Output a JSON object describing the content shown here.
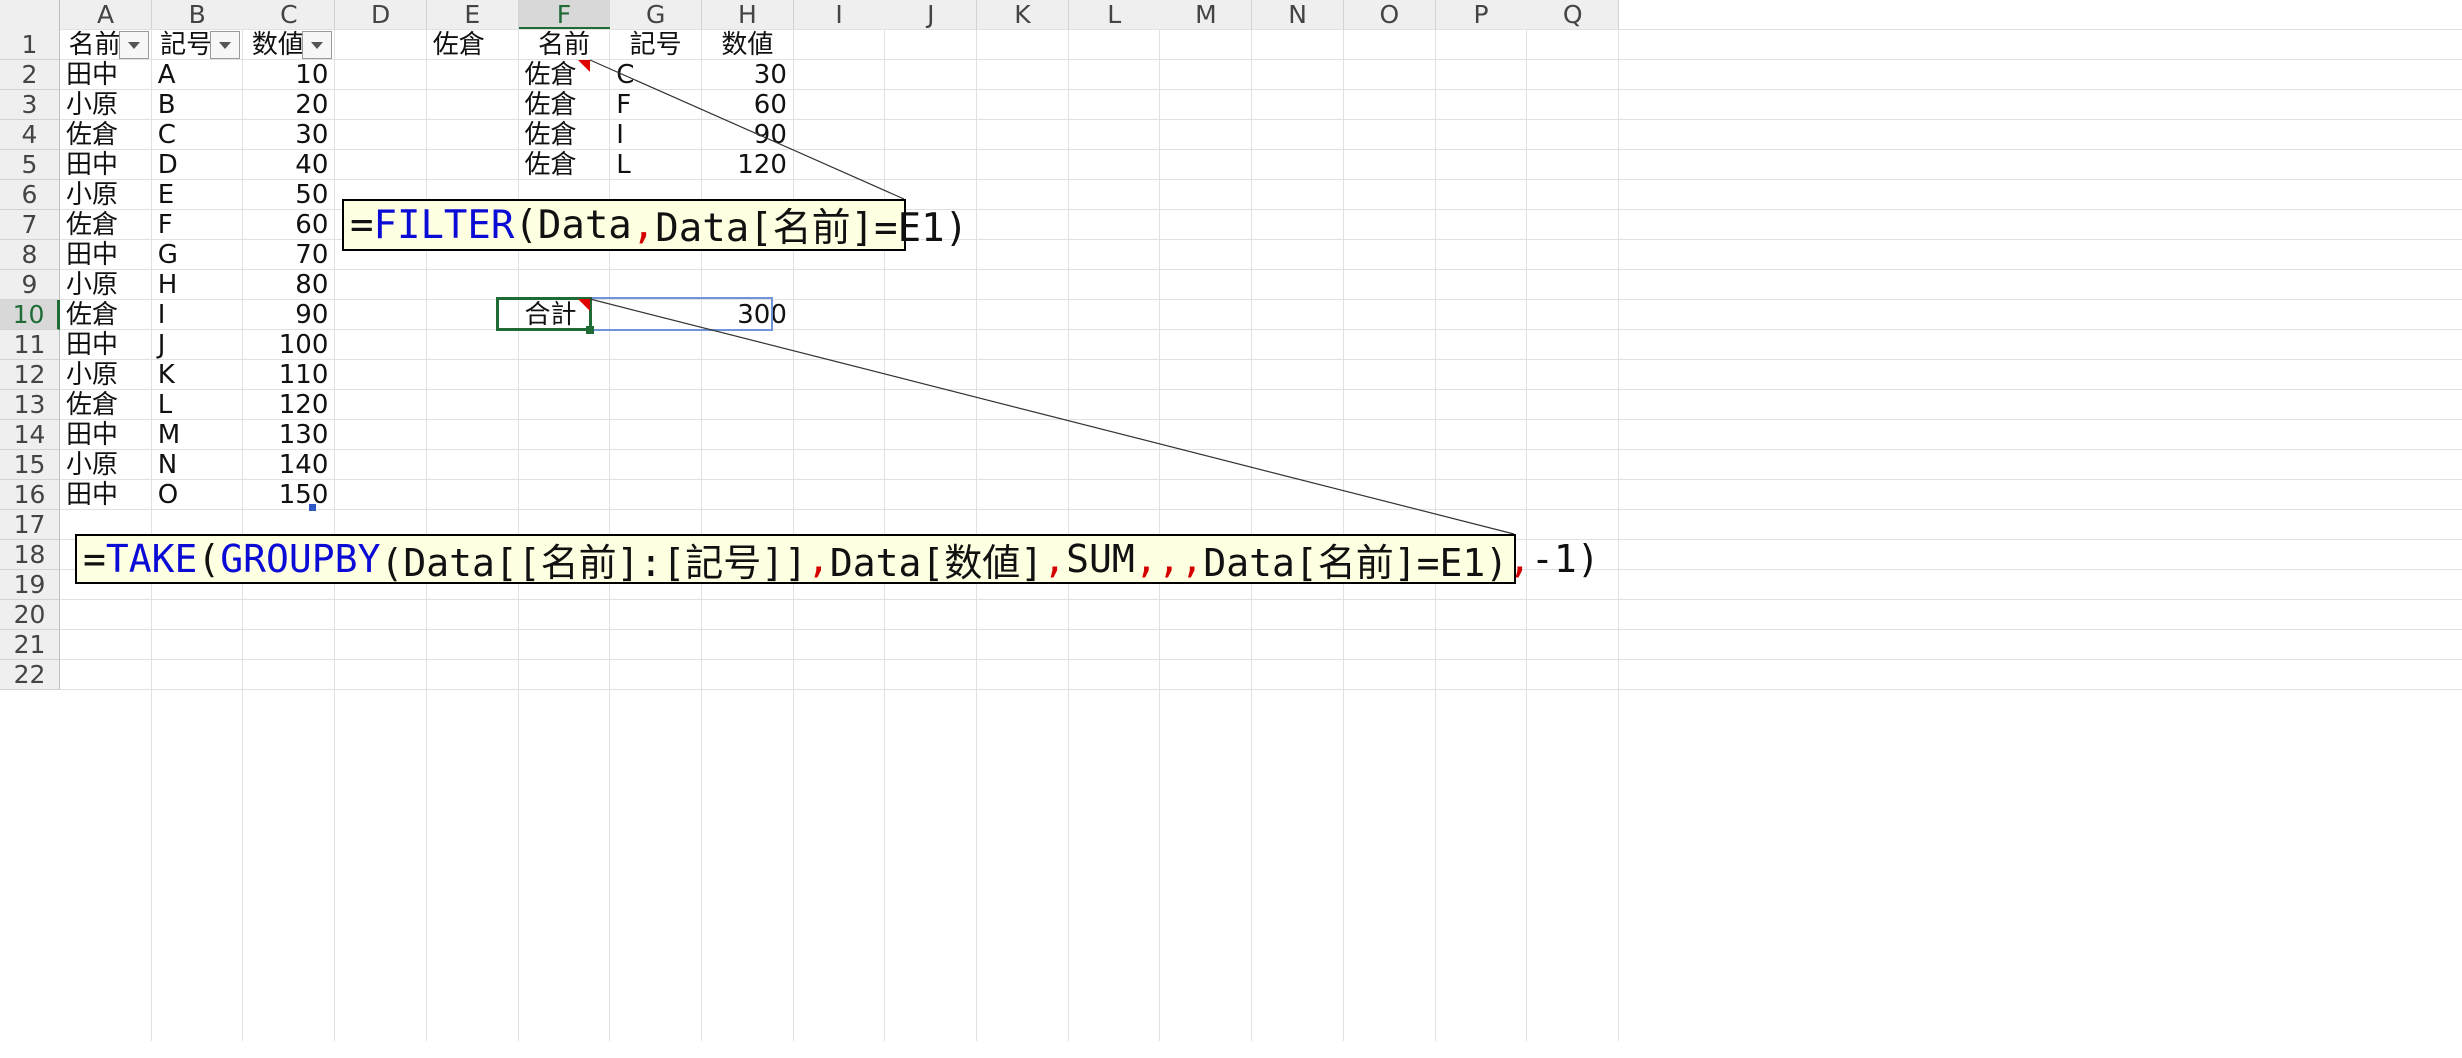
{
  "columns": [
    "A",
    "B",
    "C",
    "D",
    "E",
    "F",
    "G",
    "H",
    "I",
    "J",
    "K",
    "L",
    "M",
    "N",
    "O",
    "P",
    "Q"
  ],
  "rows": [
    "1",
    "2",
    "3",
    "4",
    "5",
    "6",
    "7",
    "8",
    "9",
    "10",
    "11",
    "12",
    "13",
    "14",
    "15",
    "16",
    "17",
    "18",
    "19",
    "20",
    "21",
    "22"
  ],
  "selected_cell": "F10",
  "table": {
    "headers": [
      "名前",
      "記号",
      "数値"
    ],
    "rows": [
      [
        "田中",
        "A",
        "10"
      ],
      [
        "小原",
        "B",
        "20"
      ],
      [
        "佐倉",
        "C",
        "30"
      ],
      [
        "田中",
        "D",
        "40"
      ],
      [
        "小原",
        "E",
        "50"
      ],
      [
        "佐倉",
        "F",
        "60"
      ],
      [
        "田中",
        "G",
        "70"
      ],
      [
        "小原",
        "H",
        "80"
      ],
      [
        "佐倉",
        "I",
        "90"
      ],
      [
        "田中",
        "J",
        "100"
      ],
      [
        "小原",
        "K",
        "110"
      ],
      [
        "佐倉",
        "L",
        "120"
      ],
      [
        "田中",
        "M",
        "130"
      ],
      [
        "小原",
        "N",
        "140"
      ],
      [
        "田中",
        "O",
        "150"
      ]
    ]
  },
  "criteria": {
    "E1": "佐倉"
  },
  "filter_result": {
    "headers": [
      "名前",
      "記号",
      "数値"
    ],
    "rows": [
      [
        "佐倉",
        "C",
        "30"
      ],
      [
        "佐倉",
        "F",
        "60"
      ],
      [
        "佐倉",
        "I",
        "90"
      ],
      [
        "佐倉",
        "L",
        "120"
      ]
    ]
  },
  "total": {
    "label": "合計",
    "value": "300"
  },
  "callout_filter": {
    "p1": "=",
    "fn1": "FILTER",
    "p2": "(Data",
    "s1": ",",
    "p3": "Data[名前]=E1)"
  },
  "callout_take": {
    "p1": "=",
    "fn1": "TAKE",
    "p2": "(",
    "fn2": "GROUPBY",
    "p3": "(Data[[名前]:[記号]]",
    "s1": ",",
    "p4": "Data[数値]",
    "s2": ",",
    "p5": "SUM",
    "s3": ",,,",
    "p6": "Data[名前]=E1)",
    "s4": ",",
    "p7": "-1)"
  },
  "colors": {
    "header_bg": "#efefef",
    "selected_header": "#1e6b35",
    "function_blue": "#0b0bd6",
    "separator_red": "#d40000",
    "callout_bg": "#ffffe1",
    "grid": "#e1e1e1"
  }
}
